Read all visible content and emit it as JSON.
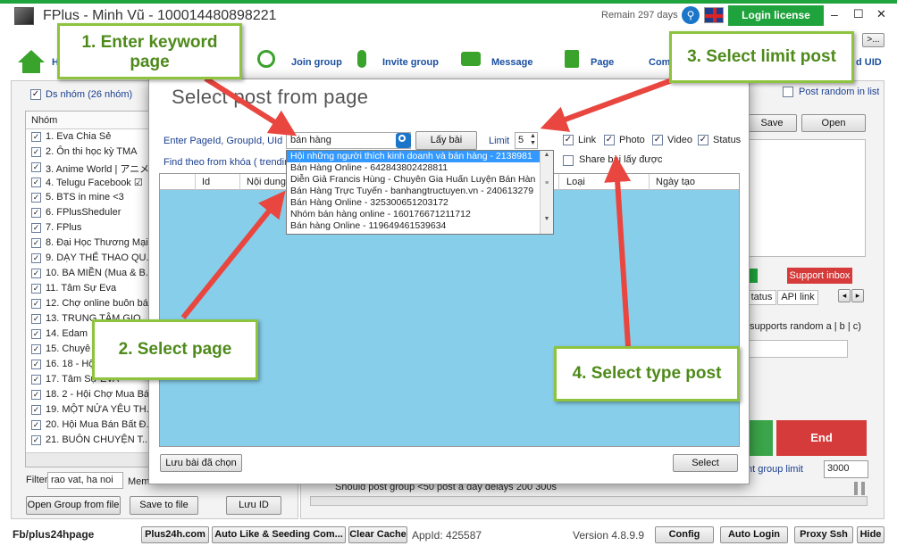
{
  "window": {
    "title": "FPlus - Minh Vũ - 100014480898221",
    "remain": "Remain 297 days",
    "login_license": "Login license",
    "minimize": "–",
    "maximize": "☐",
    "close": "✕"
  },
  "nav": {
    "home": "Ho",
    "join_group": "Join group",
    "invite_group": "Invite group",
    "message": "Message",
    "page": "Page",
    "comment": "Com",
    "uid_suffix": "d UID",
    "more": ">..."
  },
  "left": {
    "ds_nhom": "Ds nhóm (26 nhóm)",
    "col_header": "Nhóm",
    "groups": [
      "1. Eva Chia Sẻ",
      "2. Ôn thi học kỳ TMA",
      "3. Anime World | アニメ...",
      "4. Telugu Facebook ☑",
      "5. BTS in mine <3",
      "6. FPlusSheduler",
      "7. FPlus",
      "8. Đại Học Thương Mại...",
      "9. DẠY THỂ THAO QU...",
      "10. BA MIỀN (Mua & B...",
      "11. Tâm Sự Eva",
      "12. Chợ online buôn bá...",
      "13. TRUNG TÂM GIO...",
      "14. Edam",
      "15. Chuyê",
      "16. 18 - Hộ",
      "17. Tâm Sự EVA",
      "18. 2 - Hội Chợ Mua Bá...",
      "19. MỘT NỬA YÊU TH...",
      "20. Hội Mua Bán Bất Đ...",
      "21. BUÔN CHUYỆN T..."
    ],
    "filter_label": "Filter",
    "filter_value": "rao vat, ha noi",
    "member_label": "Mem",
    "open_group_file": "Open Group from file",
    "save_to_file": "Save to file",
    "luu_id": "Lưu ID"
  },
  "right": {
    "post_random": "Post random in list",
    "save": "Save",
    "open": "Open",
    "support_inbox": "Support inbox",
    "tab_status": "tatus",
    "tab_api": "API link",
    "random_hint": "supports random a | b | c)",
    "end": "End",
    "group_limit": "nt group limit",
    "group_limit_value": "3000"
  },
  "status_text": "Should post group <50 post a day delays 200 300s",
  "dialog": {
    "title": "Select post from page",
    "enter_label": "Enter PageId, GroupId, UId",
    "keyword": "bán hàng",
    "lay_bai": "Lấy bài",
    "limit_label": "Limit",
    "limit_value": "5",
    "chk_link": "Link",
    "chk_photo": "Photo",
    "chk_video": "Video",
    "chk_status": "Status",
    "share_label": "Share bài lấy được",
    "find_label": "Find theo from khóa ( trending",
    "cols": [
      "Id",
      "Nội dung",
      "Loại",
      "Ngày tạo"
    ],
    "dropdown": [
      "Hội những người thích kinh doanh và bán hàng - 2138981",
      "Bán Hàng Online - 642843802428811",
      "Diễn Giả  Francis Hùng - Chuyên Gia Huấn Luyện Bán Hàn",
      "Bán Hàng Trực Tuyến - banhangtructuyen.vn - 240613279",
      "Bán Hàng Online - 325300651203172",
      "Nhóm bán hàng online - 160176671211712",
      "Bán hàng Online - 119649461539634"
    ],
    "luu_bai": "Lưu bài đã chọn",
    "select": "Select"
  },
  "callouts": {
    "c1": "1. Enter keyword page",
    "c2": "2. Select page",
    "c3": "3. Select limit post",
    "c4": "4. Select type post"
  },
  "footer": {
    "fb": "Fb/plus24hpage",
    "plus24h": "Plus24h.com",
    "auto_like": "Auto Like & Seeding Com...",
    "clear_cache": "Clear Cache",
    "appid": "AppId: 425587",
    "version": "Version 4.8.9.9",
    "config": "Config",
    "auto_login": "Auto Login",
    "proxy": "Proxy Ssh",
    "hide": "Hide"
  },
  "colors": {
    "green": "#1fa33c",
    "list_blue": "#87ceeb",
    "end_red": "#d63b3b",
    "callout_border": "#8ec33e",
    "callout_text": "#4e8a1a",
    "arrow": "#e8463f"
  }
}
